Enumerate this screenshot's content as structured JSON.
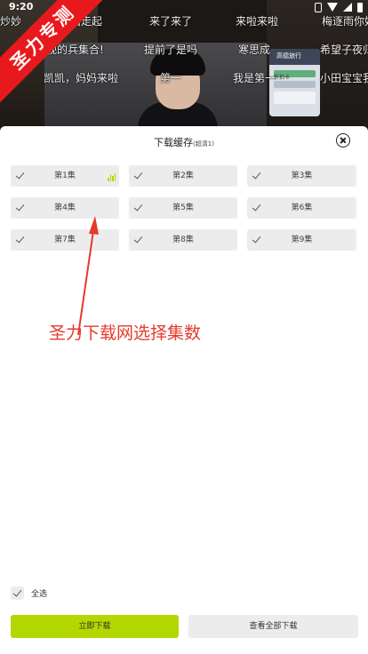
{
  "status_bar": {
    "time": "9:20"
  },
  "watermark": "圣力专测",
  "danmaku": [
    "炒妙",
    "神面走起",
    "来了来了",
    "来啦来啦",
    "梅逐雨你好",
    "桃视的兵集合!",
    "提前了是吗",
    "寒思成",
    "希望子夜归",
    "凯凯，妈妈来啦",
    "第一",
    "我是第一",
    "小田宝宝我"
  ],
  "video_ad": {
    "brand": "高德旅行",
    "line2": "折扣卡"
  },
  "sheet": {
    "title": "下载缓存",
    "quality": "(超清1)",
    "episodes": [
      {
        "label": "第1集",
        "checked": true,
        "playing": true
      },
      {
        "label": "第2集",
        "checked": true
      },
      {
        "label": "第3集",
        "checked": true
      },
      {
        "label": "第4集",
        "checked": true
      },
      {
        "label": "第5集",
        "checked": true
      },
      {
        "label": "第6集",
        "checked": true
      },
      {
        "label": "第7集",
        "checked": true
      },
      {
        "label": "第8集",
        "checked": true
      },
      {
        "label": "第9集",
        "checked": true
      }
    ],
    "annotation": "圣力下载网选择集数",
    "select_all_label": "全选",
    "download_now": "立即下载",
    "view_all_downloads": "查看全部下载"
  },
  "colors": {
    "accent": "#b3d700",
    "annotation": "#e53a2b",
    "ribbon": "#e8191c",
    "chip_bg": "#ececec"
  }
}
